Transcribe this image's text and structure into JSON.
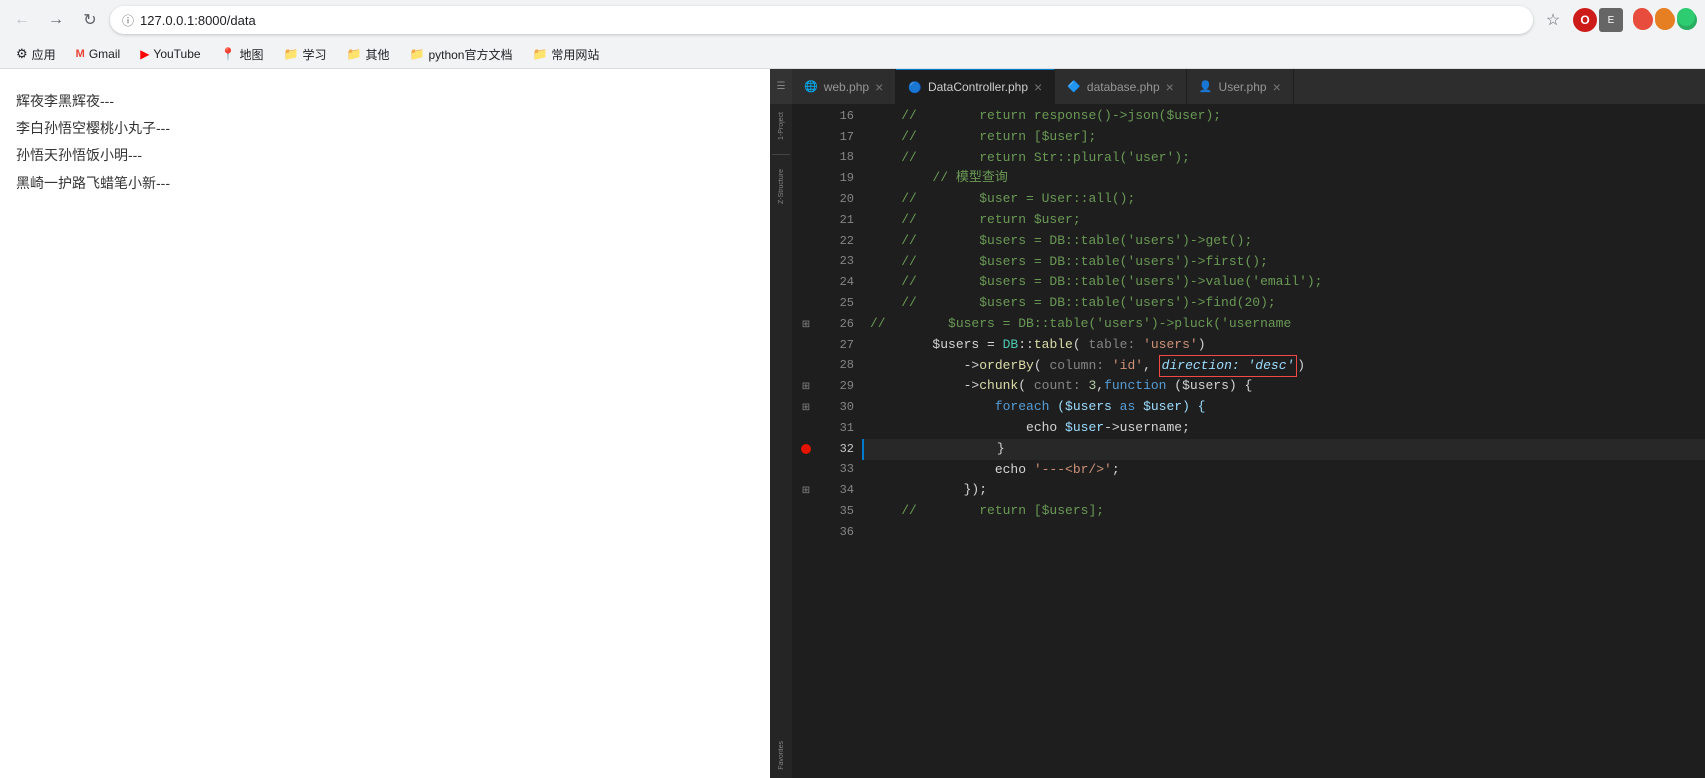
{
  "browser": {
    "url": "127.0.0.1:8000/data",
    "url_full": "127.0.0.1:8000/data",
    "bookmarks": [
      {
        "label": "应用",
        "icon": "⚙"
      },
      {
        "label": "Gmail",
        "icon": "M"
      },
      {
        "label": "YouTube",
        "icon": "▶"
      },
      {
        "label": "地图",
        "icon": "📍"
      },
      {
        "label": "学习",
        "icon": "📁"
      },
      {
        "label": "其他",
        "icon": "📁"
      },
      {
        "label": "python官方文档",
        "icon": "📁"
      },
      {
        "label": "常用网站",
        "icon": "📁"
      }
    ],
    "content_lines": [
      "辉夜李黑辉夜---",
      "李白孙悟空樱桃小丸子---",
      "孙悟天孙悟饭小明---",
      "黑崎一护路飞蜡笔小新---"
    ]
  },
  "vscode": {
    "tabs": [
      {
        "label": "web.php",
        "icon": "🌐",
        "active": false
      },
      {
        "label": "DataController.php",
        "icon": "🔵",
        "active": true
      },
      {
        "label": "database.php",
        "icon": "🔷",
        "active": false
      },
      {
        "label": "User.php",
        "icon": "👤",
        "active": false
      }
    ],
    "sidebar_labels": [
      "1-Project",
      "Z-Structure"
    ],
    "lines": [
      {
        "num": 16,
        "gutter": "",
        "code": [
          {
            "t": "    //",
            "c": "c-comment"
          },
          {
            "t": "        return ",
            "c": "c-comment"
          },
          {
            "t": "response()->json($user);",
            "c": "c-comment"
          }
        ]
      },
      {
        "num": 17,
        "gutter": "",
        "code": [
          {
            "t": "    //",
            "c": "c-comment"
          },
          {
            "t": "        return [$user];",
            "c": "c-comment"
          }
        ]
      },
      {
        "num": 18,
        "gutter": "",
        "code": [
          {
            "t": "    //",
            "c": "c-comment"
          },
          {
            "t": "        return ",
            "c": "c-comment"
          },
          {
            "t": "Str::plural('user');",
            "c": "c-comment"
          }
        ]
      },
      {
        "num": 19,
        "gutter": "",
        "code": [
          {
            "t": "        // 模型查询",
            "c": "c-comment"
          }
        ]
      },
      {
        "num": 20,
        "gutter": "",
        "code": [
          {
            "t": "    //",
            "c": "c-comment"
          },
          {
            "t": "        $user = User::all();",
            "c": "c-comment"
          }
        ]
      },
      {
        "num": 21,
        "gutter": "",
        "code": [
          {
            "t": "    //",
            "c": "c-comment"
          },
          {
            "t": "        return $user;",
            "c": "c-comment"
          }
        ]
      },
      {
        "num": 22,
        "gutter": "",
        "code": [
          {
            "t": "    //",
            "c": "c-comment"
          },
          {
            "t": "        $users = DB::table('users')->get();",
            "c": "c-comment"
          }
        ]
      },
      {
        "num": 23,
        "gutter": "",
        "code": [
          {
            "t": "    //",
            "c": "c-comment"
          },
          {
            "t": "        $users = DB::table('users')->first();",
            "c": "c-comment"
          }
        ]
      },
      {
        "num": 24,
        "gutter": "",
        "code": [
          {
            "t": "    //",
            "c": "c-comment"
          },
          {
            "t": "        $users = DB::table('users')->value('email');",
            "c": "c-comment"
          }
        ]
      },
      {
        "num": 25,
        "gutter": "",
        "code": [
          {
            "t": "    //",
            "c": "c-comment"
          },
          {
            "t": "        $users = DB::table('users')->find(20);",
            "c": "c-comment"
          }
        ]
      },
      {
        "num": 26,
        "gutter": "fold",
        "code": [
          {
            "t": "//",
            "c": "c-comment"
          },
          {
            "t": "        $users = DB::table('users')->pluck('username",
            "c": "c-comment"
          }
        ]
      },
      {
        "num": 27,
        "gutter": "",
        "code": [
          {
            "t": "        $users = ",
            "c": "c-operator"
          },
          {
            "t": "DB",
            "c": "c-class"
          },
          {
            "t": "::",
            "c": "c-punct"
          },
          {
            "t": "table",
            "c": "c-function"
          },
          {
            "t": "( ",
            "c": "c-punct"
          },
          {
            "t": "table:",
            "c": "c-hint"
          },
          {
            "t": " 'users'",
            "c": "c-string"
          },
          {
            "t": ")",
            "c": "c-punct"
          }
        ]
      },
      {
        "num": 28,
        "gutter": "",
        "code": [
          {
            "t": "            ->",
            "c": "c-operator"
          },
          {
            "t": "orderBy",
            "c": "c-function"
          },
          {
            "t": "( ",
            "c": "c-punct"
          },
          {
            "t": "column:",
            "c": "c-hint"
          },
          {
            "t": " 'id'",
            "c": "c-string"
          },
          {
            "t": ", ",
            "c": "c-punct"
          },
          {
            "t": "direction: 'desc'",
            "c": "c-red-box"
          },
          {
            "t": ")",
            "c": "c-punct"
          }
        ]
      },
      {
        "num": 29,
        "gutter": "fold",
        "code": [
          {
            "t": "            ->",
            "c": "c-operator"
          },
          {
            "t": "chunk",
            "c": "c-function"
          },
          {
            "t": "( ",
            "c": "c-punct"
          },
          {
            "t": "count:",
            "c": "c-hint"
          },
          {
            "t": " 3",
            "c": "c-number"
          },
          {
            "t": ",",
            "c": "c-punct"
          },
          {
            "t": "function",
            "c": "c-keyword"
          },
          {
            "t": " ($users) {",
            "c": "c-operator"
          }
        ]
      },
      {
        "num": 30,
        "gutter": "fold",
        "code": [
          {
            "t": "                ",
            "c": "c-operator"
          },
          {
            "t": "foreach",
            "c": "c-keyword"
          },
          {
            "t": " ($users ",
            "c": "c-variable"
          },
          {
            "t": "as",
            "c": "c-keyword"
          },
          {
            "t": " $user) {",
            "c": "c-variable"
          }
        ]
      },
      {
        "num": 31,
        "gutter": "",
        "code": [
          {
            "t": "                    echo ",
            "c": "c-operator"
          },
          {
            "t": "$user",
            "c": "c-variable"
          },
          {
            "t": "->username;",
            "c": "c-operator"
          }
        ]
      },
      {
        "num": 32,
        "gutter": "bp",
        "code": [
          {
            "t": "                }",
            "c": "c-punct"
          }
        ],
        "active": true
      },
      {
        "num": 33,
        "gutter": "",
        "code": [
          {
            "t": "                echo ",
            "c": "c-operator"
          },
          {
            "t": "'---<br/>'",
            "c": "c-string"
          },
          {
            "t": ";",
            "c": "c-punct"
          }
        ]
      },
      {
        "num": 34,
        "gutter": "fold",
        "code": [
          {
            "t": "            });",
            "c": "c-punct"
          }
        ]
      },
      {
        "num": 35,
        "gutter": "",
        "code": [
          {
            "t": "    //",
            "c": "c-comment"
          },
          {
            "t": "        return [$users];",
            "c": "c-comment"
          }
        ]
      },
      {
        "num": 36,
        "gutter": "",
        "code": []
      }
    ]
  }
}
